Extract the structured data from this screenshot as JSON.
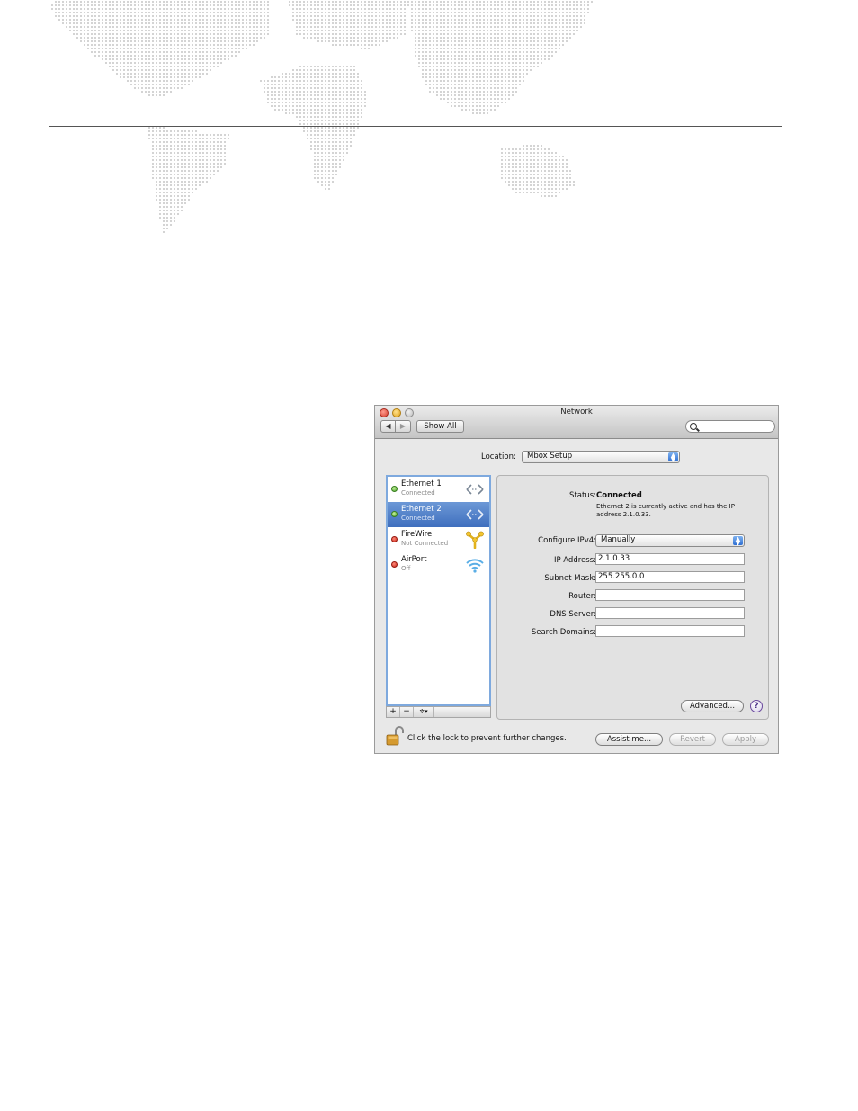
{
  "window": {
    "title": "Network",
    "nav_back": "◀",
    "nav_forward": "▶",
    "show_all": "Show All",
    "search_placeholder": ""
  },
  "location": {
    "label": "Location:",
    "value": "Mbox Setup"
  },
  "services": [
    {
      "name": "Ethernet 1",
      "status": "Connected",
      "indicator": "green",
      "icon": "ethernet-icon",
      "selected": false
    },
    {
      "name": "Ethernet 2",
      "status": "Connected",
      "indicator": "green",
      "icon": "ethernet-icon",
      "selected": true
    },
    {
      "name": "FireWire",
      "status": "Not Connected",
      "indicator": "red",
      "icon": "firewire-icon",
      "selected": false
    },
    {
      "name": "AirPort",
      "status": "Off",
      "indicator": "red",
      "icon": "wifi-icon",
      "selected": false
    }
  ],
  "sidebar_tools": {
    "add": "+",
    "remove": "−",
    "action": "✲▾"
  },
  "detail": {
    "status_label": "Status:",
    "status_value": "Connected",
    "status_description": "Ethernet 2 is currently active and has the IP address 2.1.0.33.",
    "configure_label": "Configure IPv4:",
    "configure_value": "Manually",
    "ip_label": "IP Address:",
    "ip_value": "2.1.0.33",
    "subnet_label": "Subnet Mask:",
    "subnet_value": "255.255.0.0",
    "router_label": "Router:",
    "router_value": "",
    "dns_label": "DNS Server:",
    "dns_value": "",
    "search_domains_label": "Search Domains:",
    "search_domains_value": "",
    "advanced_button": "Advanced...",
    "help_button": "?"
  },
  "footer": {
    "lock_text": "Click the lock to prevent further changes.",
    "assist_button": "Assist me...",
    "revert_button": "Revert",
    "apply_button": "Apply"
  },
  "colors": {
    "selection": "#3f6fbe",
    "status_green": "#4aa329",
    "status_red": "#c9261a",
    "map_dots": "#b5b5b5"
  }
}
